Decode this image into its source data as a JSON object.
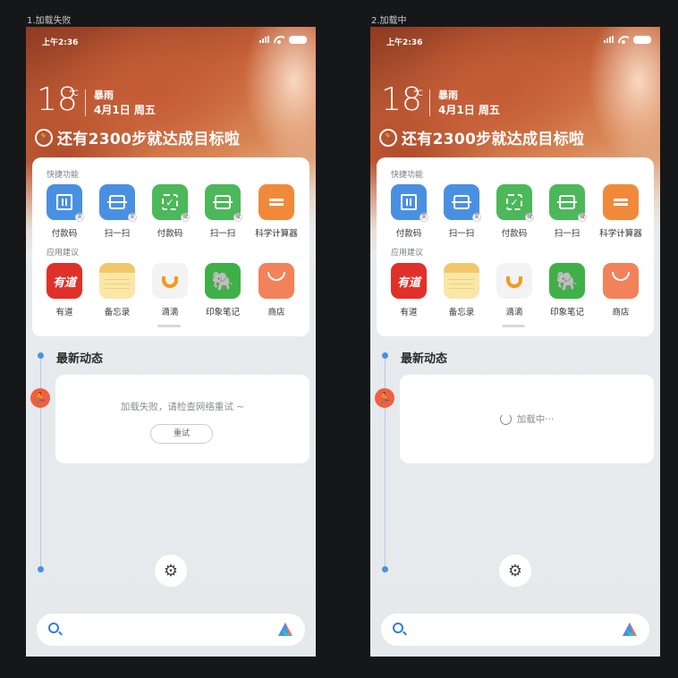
{
  "screens": [
    {
      "caption": "1.加载失败",
      "status_time": "上午2:36",
      "weather": {
        "temp": "18",
        "unit": "°C",
        "condition": "暴雨",
        "date": "4月1日 周五"
      },
      "steps_text": "还有2300步就达成目标啦",
      "quick_title": "快捷功能",
      "quick_items": [
        "付款码",
        "扫一扫",
        "付款码",
        "扫一扫",
        "科学计算器"
      ],
      "suggest_title": "应用建议",
      "suggest_items": [
        "有道",
        "备忘录",
        "滴滴",
        "印象笔记",
        "商店"
      ],
      "youdao_logo": "有道",
      "feed_title": "最新动态",
      "feed": {
        "state": "error",
        "message": "加载失败，请检查网络重试 ~",
        "retry_label": "重试"
      }
    },
    {
      "caption": "2.加载中",
      "status_time": "上午2:36",
      "weather": {
        "temp": "18",
        "unit": "°C",
        "condition": "暴雨",
        "date": "4月1日 周五"
      },
      "steps_text": "还有2300步就达成目标啦",
      "quick_title": "快捷功能",
      "quick_items": [
        "付款码",
        "扫一扫",
        "付款码",
        "扫一扫",
        "科学计算器"
      ],
      "suggest_title": "应用建议",
      "suggest_items": [
        "有道",
        "备忘录",
        "滴滴",
        "印象笔记",
        "商店"
      ],
      "youdao_logo": "有道",
      "feed_title": "最新动态",
      "feed": {
        "state": "loading",
        "message": "加载中···"
      }
    }
  ],
  "colors": {
    "blue_app": "#4a90e2",
    "green_app": "#4cb85a",
    "orange_app": "#f08a3a",
    "youdao_red": "#e0302a",
    "evernote_green": "#3fb047",
    "shop_orange": "#f2825a",
    "timeline_blue": "#4b8fe5",
    "step_red": "#f0603f"
  },
  "icons": {
    "quick": [
      "pay-code-icon",
      "scan-icon",
      "pay-code-icon",
      "scan-icon",
      "calculator-icon"
    ],
    "suggest": [
      "youdao-icon",
      "notes-icon",
      "didi-icon",
      "evernote-icon",
      "shop-icon"
    ]
  }
}
